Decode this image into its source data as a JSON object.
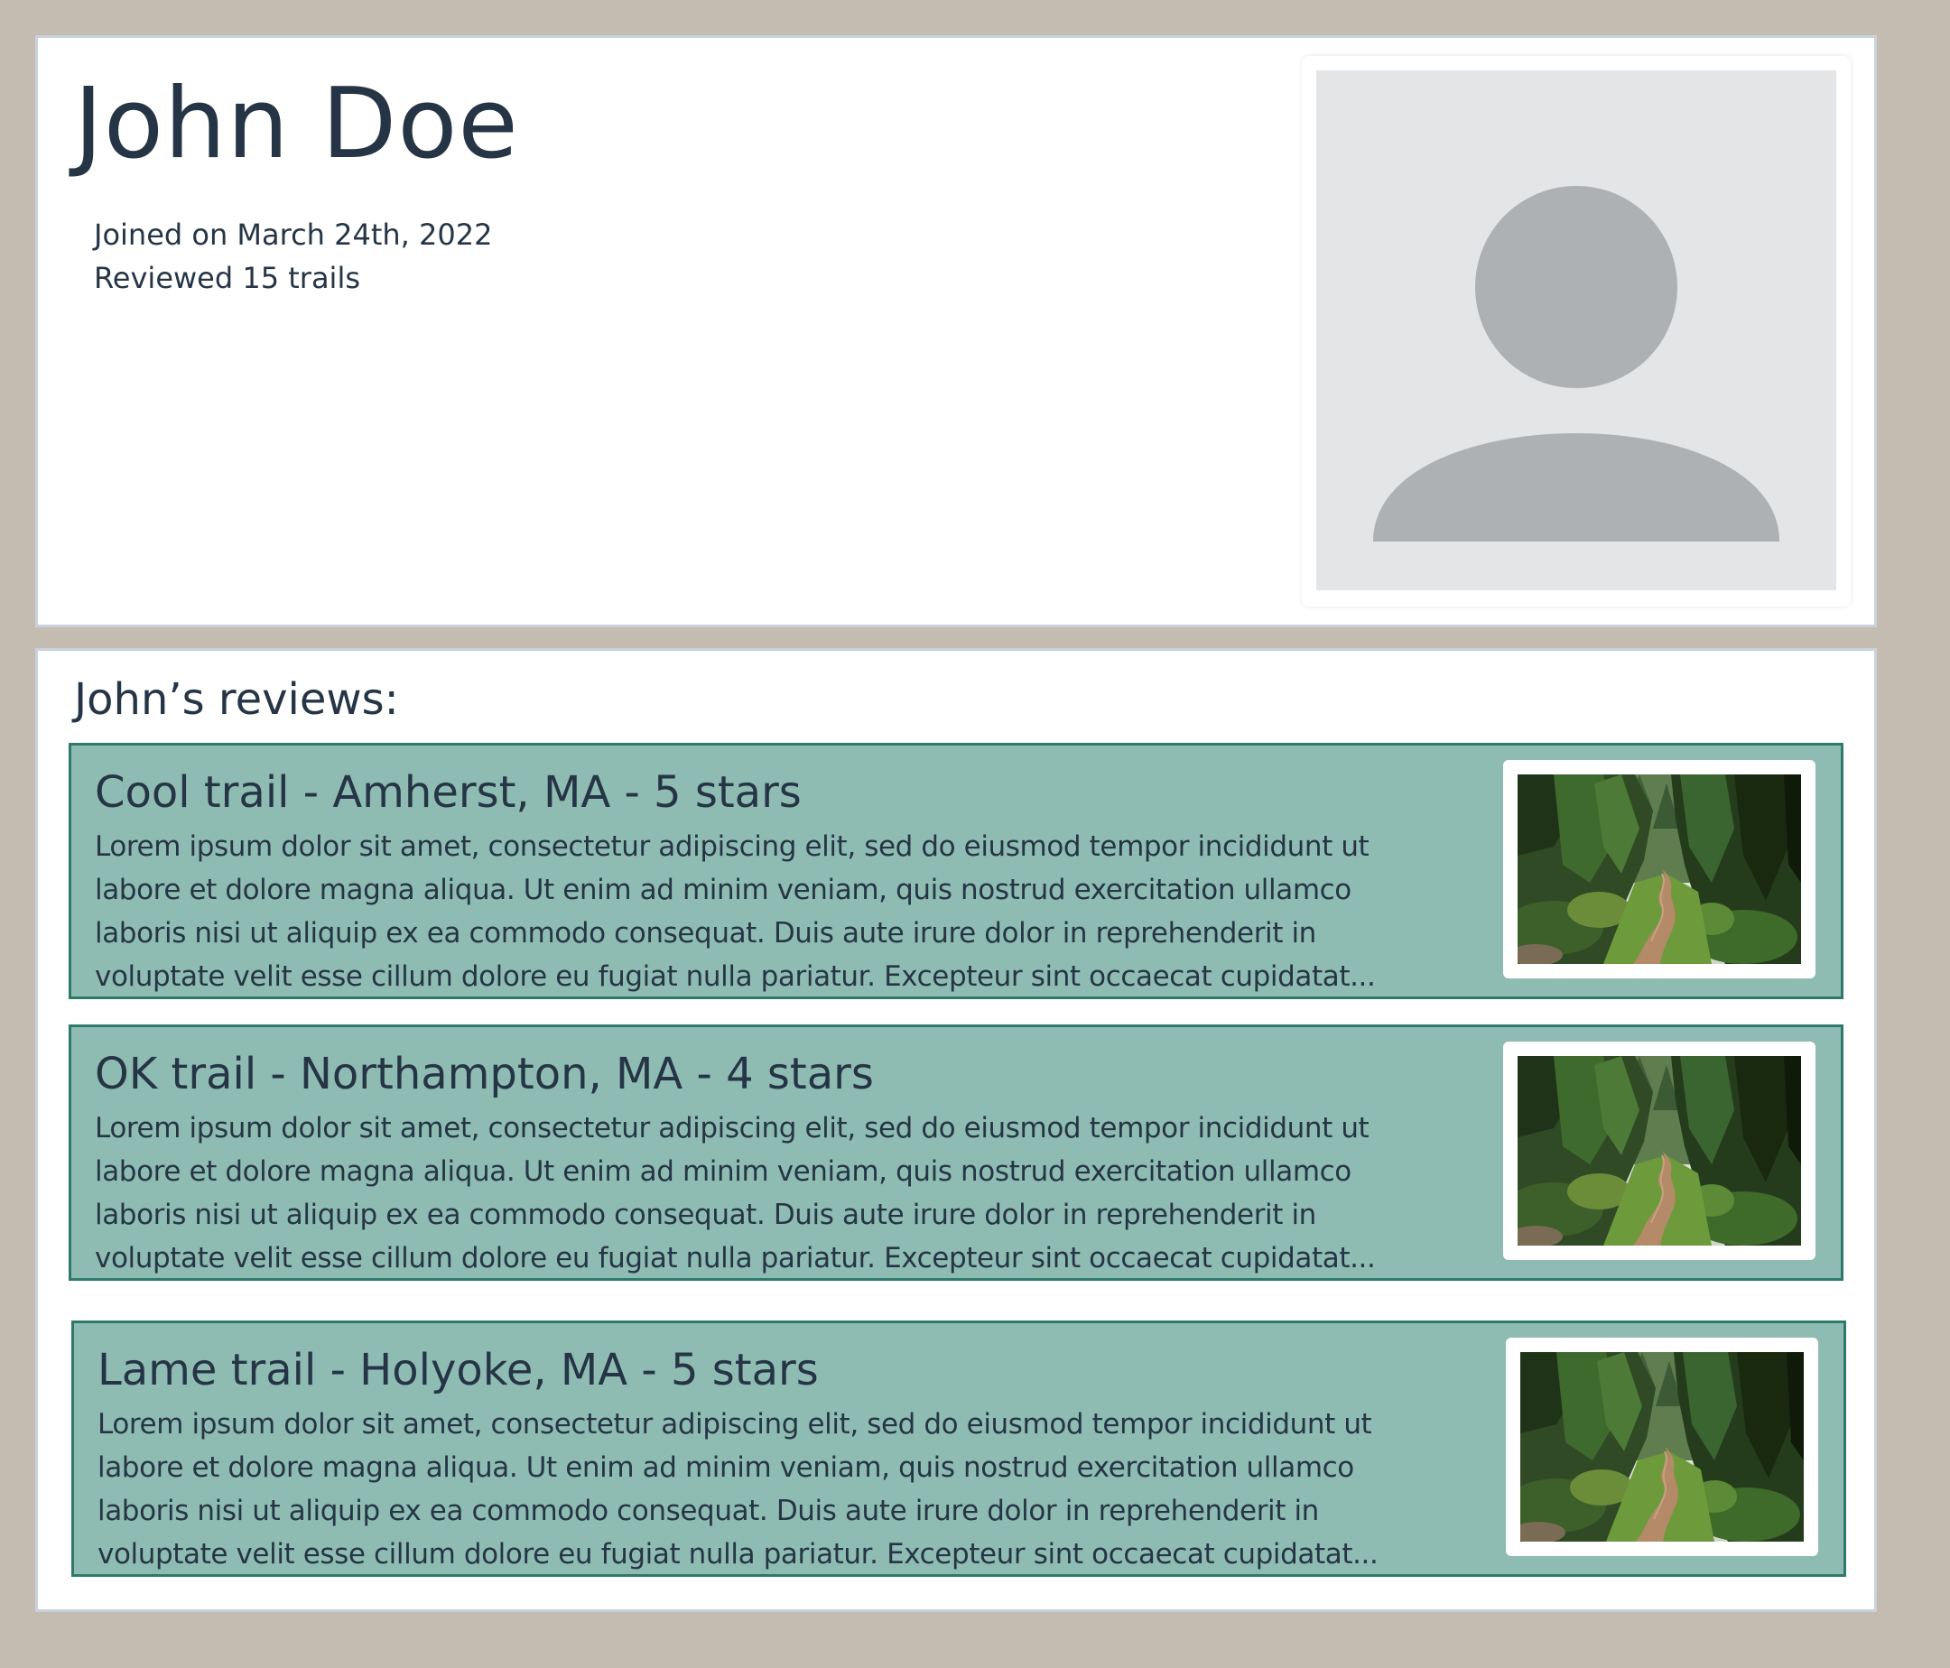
{
  "profile": {
    "name": "John Doe",
    "joined_text": "Joined on March 24th, 2022",
    "reviewed_text": "Reviewed 15 trails",
    "avatar_icon": "user-silhouette-icon"
  },
  "reviews": {
    "heading": "John’s reviews:",
    "items": [
      {
        "title": "Cool trail - Amherst, MA - 5 stars",
        "body_lines": [
          "Lorem ipsum dolor sit amet, consectetur adipiscing elit, sed do eiusmod tempor incididunt ut",
          "labore et dolore magna aliqua. Ut enim ad minim veniam, quis nostrud exercitation ullamco",
          "laboris nisi ut aliquip ex ea commodo consequat. Duis aute irure dolor in reprehenderit in",
          "voluptate velit esse cillum dolore eu fugiat nulla pariatur. Excepteur sint occaecat cupidatat..."
        ],
        "image": "forest-trail-photo"
      },
      {
        "title": "OK trail - Northampton, MA - 4 stars",
        "body_lines": [
          "Lorem ipsum dolor sit amet, consectetur adipiscing elit, sed do eiusmod tempor incididunt ut",
          "labore et dolore magna aliqua. Ut enim ad minim veniam, quis nostrud exercitation ullamco",
          "laboris nisi ut aliquip ex ea commodo consequat. Duis aute irure dolor in reprehenderit in",
          "voluptate velit esse cillum dolore eu fugiat nulla pariatur. Excepteur sint occaecat cupidatat..."
        ],
        "image": "forest-trail-photo"
      },
      {
        "title": "Lame trail - Holyoke, MA - 5 stars",
        "body_lines": [
          "Lorem ipsum dolor sit amet, consectetur adipiscing elit, sed do eiusmod tempor incididunt ut",
          "labore et dolore magna aliqua. Ut enim ad minim veniam, quis nostrud exercitation ullamco",
          "laboris nisi ut aliquip ex ea commodo consequat. Duis aute irure dolor in reprehenderit in",
          "voluptate velit esse cillum dolore eu fugiat nulla pariatur. Excepteur sint occaecat cupidatat..."
        ],
        "image": "forest-trail-photo"
      }
    ]
  },
  "colors": {
    "page_background": "#c4bcb0",
    "card_background": "#ffffff",
    "review_background": "#8fbcb2",
    "review_border": "#2e7a6a",
    "text": "#263545",
    "avatar_background": "#e4e5e7",
    "avatar_silhouette": "#adb1b4"
  }
}
